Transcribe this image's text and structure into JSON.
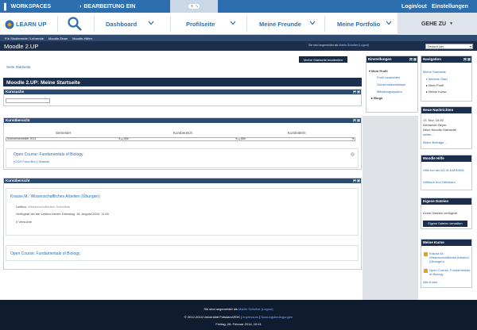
{
  "topbar": {
    "workspaces": "WORKSPACES",
    "bearbeitung": "BEARBEITUNG EIN",
    "login_out": "Login/out",
    "einstellungen": "Einstellungen"
  },
  "logo": {
    "text": "LEARN UP"
  },
  "nav": {
    "items": [
      {
        "label": "Dashboard"
      },
      {
        "label": "Profilseite"
      },
      {
        "label": "Meine Freunde"
      },
      {
        "label": "Meine Portfolio"
      }
    ],
    "goto": "GEHE ZU"
  },
  "subnav": {
    "items": [
      "Für Studierende / Lehrende",
      "Moodle-Team",
      "Moodle-Hilfen"
    ]
  },
  "titlebar": {
    "title": "Moodle 2.UP",
    "login_prefix": "Sie sind angemeldet als",
    "login_user": "Martin Schultze",
    "login_logout": "(Logout)",
    "lang": "Deutsch (de)"
  },
  "page": {
    "breadcrumb": "Seite Startseite",
    "edit_button": "Meine Startseite bearbeiten",
    "main_header": "Moodle 2.UP: Meine Startseite"
  },
  "kurssuche": {
    "title": "Kurssuche"
  },
  "kursuebersicht1": {
    "title": "Kursübersicht",
    "semester_label": "Semester",
    "kursbereich_label": "Kursbereich",
    "kursleiterin_label": "Kursleiterin",
    "semester_value": "Sommersemester 2013",
    "kursbereich_value": "Alle",
    "kursleiterin_value": "Alle",
    "course_title": "Open Course: Fundamentals of Biology",
    "course_links": "(OCH Fund.Bio) | Wassip"
  },
  "kursuebersicht2": {
    "title": "Kursübersicht",
    "course1_title": "Krause,M.: Wissenschaftliches Arbeiten (Übungen)",
    "lektion_label": "Lektion:",
    "lektion_value": "Wissenschaftliches Schreiben",
    "verfuegbar": "Verfügbar bei der Lektion endet: Dienstag, 18. August 2020, 11:00",
    "versuche": "0 Versuche",
    "course2_title": "Open Course: Fundamentals of Biology"
  },
  "einstellungen": {
    "title": "Einstellungen",
    "mein_profil": "Mein Profil",
    "items": [
      "Profil bearbeiten",
      "Sicherheitsschlüssel",
      "Mitteilungssystem"
    ],
    "blogs": "Blogs"
  },
  "navigation": {
    "title": "Navigation",
    "meine_startseite": "Meine Startseite",
    "website_start": "Website-Start",
    "mein_profil": "Mein Profil",
    "meine_kurse": "Meine Kurse"
  },
  "nachrichten": {
    "title": "Neue Nachrichten",
    "date": "13. Nov, 15:39",
    "author": "Alexander Beyer",
    "text": "Neue Moodle-Startseite",
    "more": "weiter...",
    "all": "Ältere Beiträge ..."
  },
  "hilfe": {
    "title": "Moodle Hilfe",
    "link1": "Hilfe bei der AG eLEARNING",
    "link2": "Hilfeture und Hilfeteam"
  },
  "dateien": {
    "title": "Eigene Dateien",
    "text": "Keine Dateien verfügbar",
    "button": "Eigene Dateien verwalten"
  },
  "kurse": {
    "title": "Meine Kurse",
    "course1": "Krause,M.: Wissenschaftliches Arbeiten (Übungen)",
    "course2": "Open Course: Fundamentals of Biology",
    "all": "Alle Kurse ..."
  },
  "footer": {
    "login_prefix": "Sie sind angemeldet als",
    "login_user": "Martin Schultze",
    "logout": "(Logout)",
    "copyright": "© 2012-2014 Universität Potsdam/ZEIK |",
    "impressum": "Impressum",
    "nutzung": "Nutzungsbedingungen",
    "date": "Freitag, 28. Februar 2014, 10:41"
  },
  "colors": {
    "brand": "#2d6fae",
    "dark": "#1b2f4c",
    "block_head": "#2b4a73"
  },
  "icons": [
    "search-icon",
    "gamepad-icon",
    "chevron-down-icon",
    "caret-down-icon",
    "course-icon"
  ]
}
